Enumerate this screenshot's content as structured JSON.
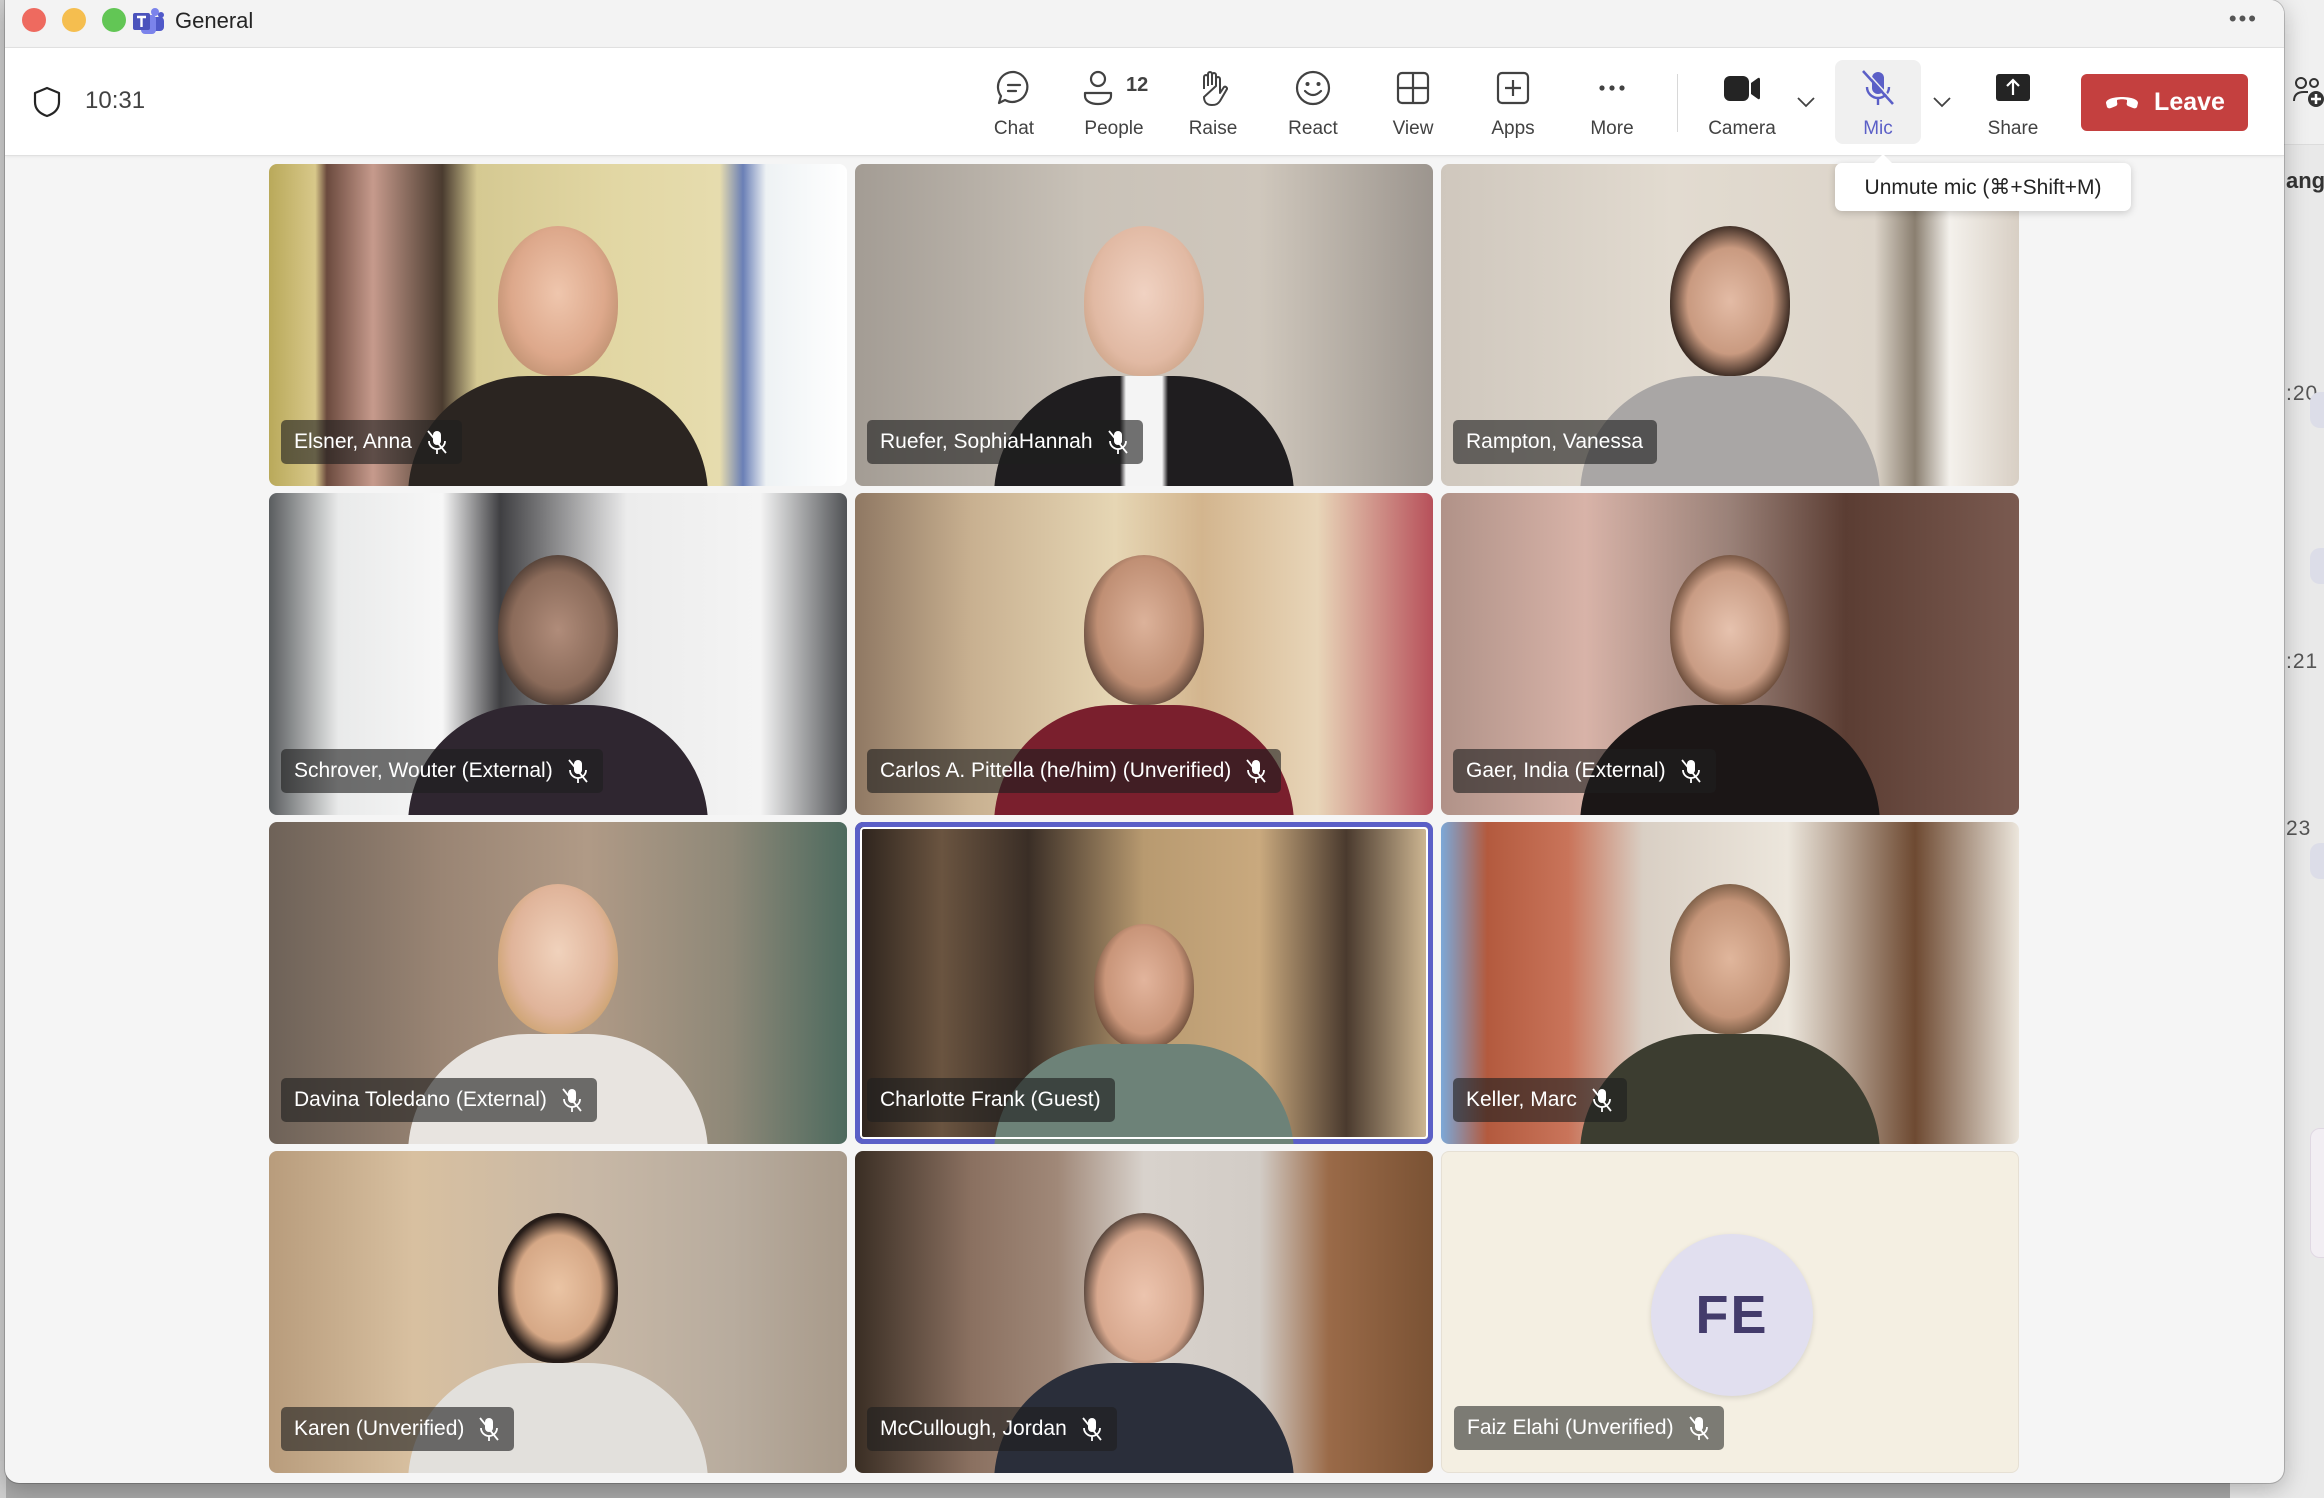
{
  "window": {
    "title": "General",
    "more_label": "•••"
  },
  "meeting": {
    "elapsed_time": "10:31"
  },
  "toolbar": {
    "items": [
      {
        "id": "chat",
        "label": "Chat",
        "icon": "chat-icon"
      },
      {
        "id": "people",
        "label": "People",
        "icon": "people-icon",
        "count": "12"
      },
      {
        "id": "raise",
        "label": "Raise",
        "icon": "hand-icon"
      },
      {
        "id": "react",
        "label": "React",
        "icon": "smiley-icon"
      },
      {
        "id": "view",
        "label": "View",
        "icon": "grid-icon"
      },
      {
        "id": "apps",
        "label": "Apps",
        "icon": "plus-box-icon"
      },
      {
        "id": "more",
        "label": "More",
        "icon": "ellipsis-icon"
      },
      {
        "id": "camera",
        "label": "Camera",
        "icon": "video-camera-icon"
      },
      {
        "id": "mic",
        "label": "Mic",
        "icon": "mic-off-icon",
        "state": "muted"
      },
      {
        "id": "share",
        "label": "Share",
        "icon": "share-screen-icon"
      }
    ],
    "leave_label": "Leave",
    "mic_tooltip": "Unmute mic (⌘+Shift+M)"
  },
  "colors": {
    "accent": "#5b5fc7",
    "leave": "#c4403f"
  },
  "participants": [
    {
      "name": "Elsner, Anna",
      "muted": true,
      "video": true
    },
    {
      "name": "Ruefer, SophiaHannah",
      "muted": true,
      "video": true
    },
    {
      "name": "Rampton, Vanessa",
      "muted": false,
      "video": true
    },
    {
      "name": "Schrover, Wouter (External)",
      "muted": true,
      "video": true
    },
    {
      "name": "Carlos A. Pittella (he/him) (Unverified)",
      "muted": true,
      "video": true
    },
    {
      "name": "Gaer, India (External)",
      "muted": true,
      "video": true
    },
    {
      "name": "Davina Toledano (External)",
      "muted": true,
      "video": true
    },
    {
      "name": "Charlotte Frank (Guest)",
      "muted": false,
      "video": true,
      "active_speaker": true
    },
    {
      "name": "Keller, Marc",
      "muted": true,
      "video": true
    },
    {
      "name": "Karen (Unverified)",
      "muted": true,
      "video": true
    },
    {
      "name": "McCullough, Jordan",
      "muted": true,
      "video": true
    },
    {
      "name": "Faiz Elahi (Unverified)",
      "muted": true,
      "video": false,
      "initials": "FE"
    }
  ],
  "background_app": {
    "partial_text": "ang",
    "times": [
      ":20",
      ":21",
      "23"
    ]
  }
}
